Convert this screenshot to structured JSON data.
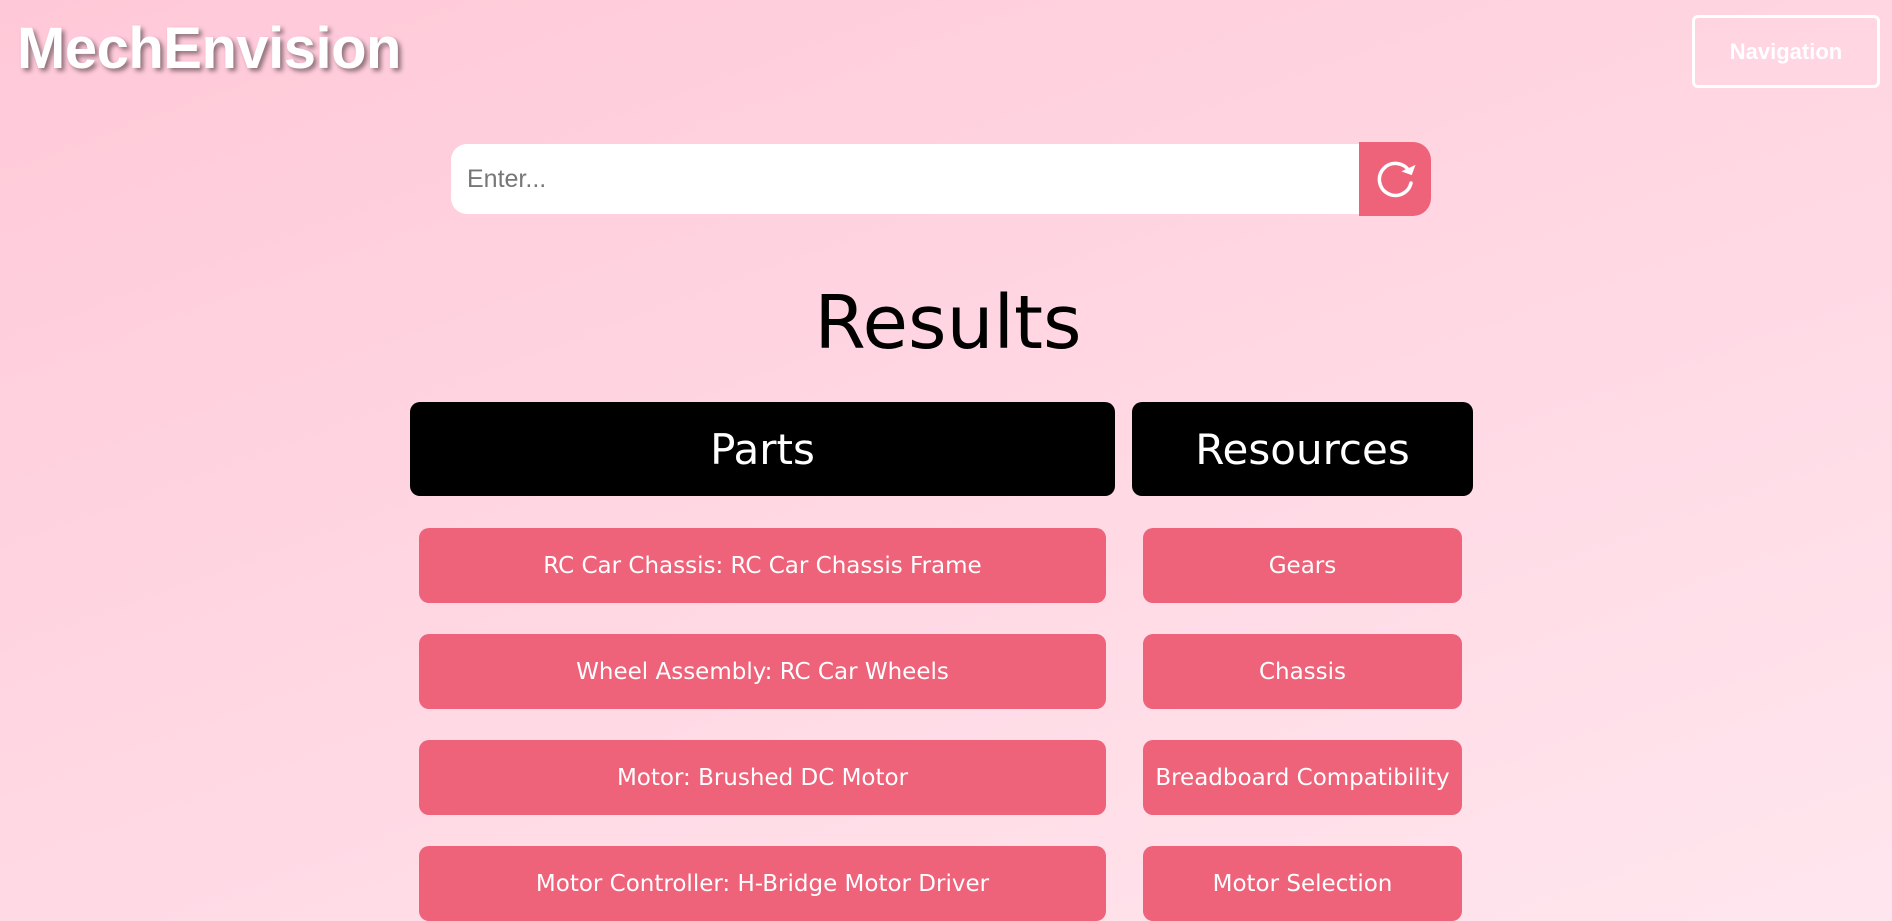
{
  "header": {
    "logo": "MechEnvision",
    "nav_label": "Navigation"
  },
  "search": {
    "placeholder": "Enter...",
    "value": "",
    "button_icon": "refresh-icon"
  },
  "results": {
    "title": "Results",
    "parts": {
      "heading": "Parts",
      "items": [
        "RC Car Chassis: RC Car Chassis Frame",
        "Wheel Assembly: RC Car Wheels",
        "Motor: Brushed DC Motor",
        "Motor Controller: H-Bridge Motor Driver"
      ]
    },
    "resources": {
      "heading": "Resources",
      "items": [
        "Gears",
        "Chassis",
        "Breadboard Compatibility",
        "Motor Selection"
      ]
    }
  },
  "colors": {
    "accent": "#ee627a",
    "header_bg": "#000000",
    "background": "#ffd6e2"
  }
}
